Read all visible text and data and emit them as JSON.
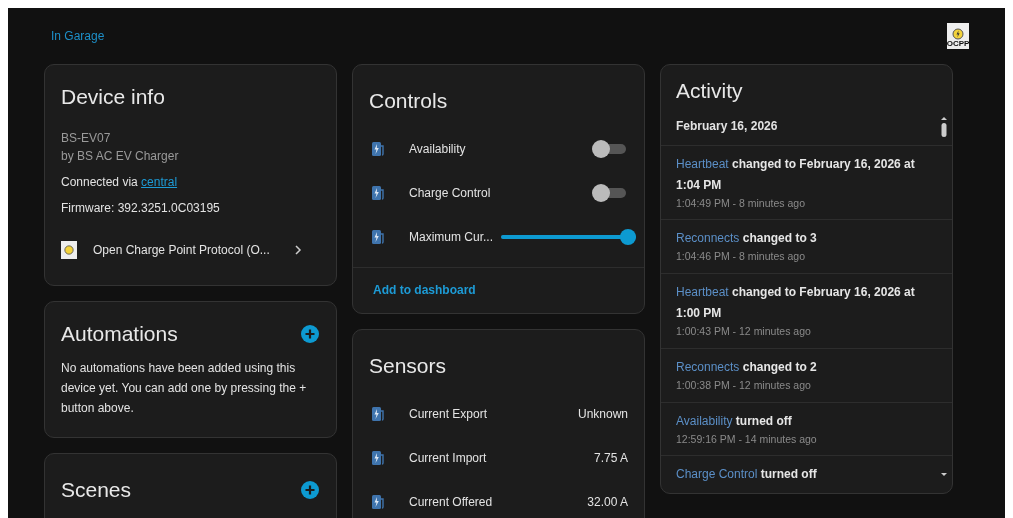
{
  "breadcrumb": "In Garage",
  "logo": {
    "text": "OCPP"
  },
  "device_info": {
    "title": "Device info",
    "model": "BS-EV07",
    "manufacturer": "by BS AC EV Charger",
    "connected_label": "Connected via",
    "connected_link": "central",
    "firmware": "Firmware: 392.3251.0C03195",
    "integration": "Open Charge Point Protocol (O..."
  },
  "automations": {
    "title": "Automations",
    "text": "No automations have been added using this device yet. You can add one by pressing the + button above."
  },
  "scenes": {
    "title": "Scenes"
  },
  "controls": {
    "title": "Controls",
    "items": [
      {
        "kind": "toggle",
        "label": "Availability",
        "on": false
      },
      {
        "kind": "toggle",
        "label": "Charge Control",
        "on": false
      },
      {
        "kind": "slider",
        "label": "Maximum Cur...",
        "level": 1.0
      }
    ],
    "footer_link": "Add to dashboard"
  },
  "sensors": {
    "title": "Sensors",
    "items": [
      {
        "label": "Current Export",
        "value": "Unknown"
      },
      {
        "label": "Current Import",
        "value": "7.75 A"
      },
      {
        "label": "Current Offered",
        "value": "32.00 A"
      }
    ]
  },
  "activity": {
    "title": "Activity",
    "date": "February 16, 2026",
    "entries": [
      {
        "entity": "Heartbeat",
        "message": "changed to February 16, 2026 at 1:04 PM",
        "time": "1:04:49 PM - 8 minutes ago"
      },
      {
        "entity": "Reconnects",
        "message": "changed to 3",
        "time": "1:04:46 PM - 8 minutes ago"
      },
      {
        "entity": "Heartbeat",
        "message": "changed to February 16, 2026 at 1:00 PM",
        "time": "1:00:43 PM - 12 minutes ago"
      },
      {
        "entity": "Reconnects",
        "message": "changed to 2",
        "time": "1:00:38 PM - 12 minutes ago"
      },
      {
        "entity": "Availability",
        "message": "turned off",
        "time": "12:59:16 PM - 14 minutes ago"
      },
      {
        "entity": "Charge Control",
        "message": "turned off"
      }
    ]
  }
}
